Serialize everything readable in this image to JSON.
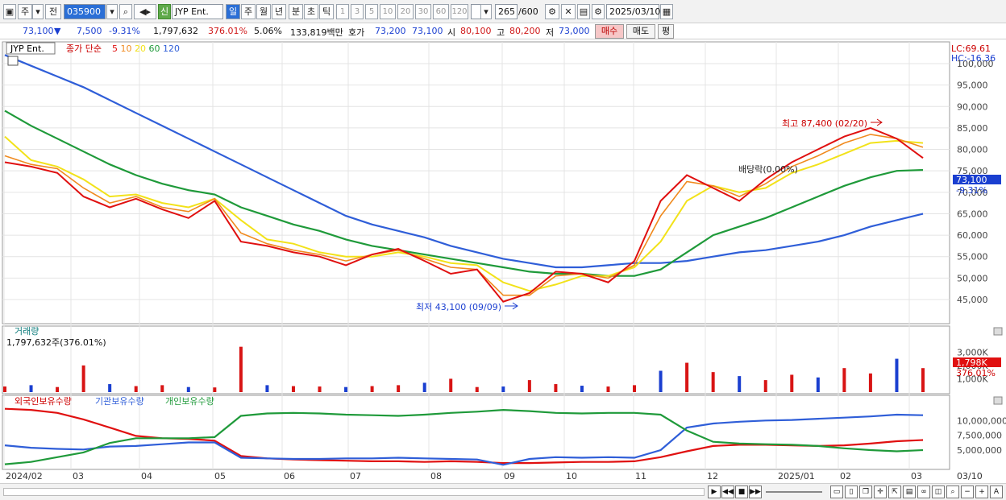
{
  "toolbar": {
    "type_select": "주",
    "prev_label": "전",
    "stock_code": "035900",
    "credit_badge": "신",
    "stock_name": "JYP Ent.",
    "periods": [
      "일",
      "주",
      "월",
      "년",
      "분",
      "초",
      "틱"
    ],
    "active_period": "일",
    "intervals": [
      "1",
      "3",
      "5",
      "10",
      "20",
      "30",
      "60",
      "120"
    ],
    "data_count": "265",
    "data_total": "/600",
    "date": "2025/03/10"
  },
  "quote": {
    "price": "73,100",
    "change": "7,500",
    "change_pct": "-9.31%",
    "volume": "1,797,632",
    "volume_ratio": "376.01%",
    "turnover": "5.06%",
    "amount": "133,819백만",
    "ask_label": "호가",
    "ask1": "73,200",
    "ask2": "73,100",
    "open_label": "시",
    "open": "80,100",
    "high_label": "고",
    "high": "80,200",
    "low_label": "저",
    "low": "73,000",
    "buy_label": "매수",
    "sell_label": "매도",
    "eval_label": "평"
  },
  "chart_labels": {
    "name_tag": "JYP Ent.",
    "ma_prefix": "종가 단순",
    "lc": "LC:69.61",
    "hc": "HC:-16.36",
    "max_annot": "최고 87,400 (02/20)",
    "min_annot": "최저 43,100 (09/09)",
    "div_annot": "배당락(0.00%)",
    "price_tag": "73,100",
    "pct_tag": "-9.31%",
    "vol_title": "거래량",
    "vol_value": "1,797,632주(376.01%)",
    "vol_tag": "1,798K",
    "vol_pct_tag": "376.01%",
    "holdings": [
      "외국인보유수량",
      "기관보유수량",
      "개인보유수량"
    ]
  },
  "colors": {
    "up": "#d81414",
    "down": "#1a3fd0",
    "ma5": "#e01010",
    "ma10": "#f08a1e",
    "ma20": "#f2e21a",
    "ma60": "#1f9a3a",
    "ma120": "#2f5ed8",
    "foreign": "#e01010",
    "institution": "#2f5ed8",
    "individual": "#1f9a3a"
  },
  "chart_data": {
    "type": "line",
    "series": [
      {
        "name": "5",
        "values": [
          77000,
          76000,
          74500,
          69000,
          66500,
          68500,
          66000,
          64000,
          68000,
          58500,
          57500,
          56000,
          55000,
          53000,
          55500,
          56800,
          54000,
          51000,
          52000,
          44500,
          46500,
          51500,
          51000,
          49000,
          54000,
          68000,
          74000,
          71000,
          68000,
          73000,
          77000,
          80000,
          83000,
          85000,
          82500,
          78000
        ]
      },
      {
        "name": "10",
        "values": [
          78500,
          76500,
          75500,
          71000,
          67500,
          69000,
          66500,
          65500,
          68500,
          60500,
          58000,
          56500,
          55500,
          54000,
          55500,
          56500,
          54500,
          52500,
          52000,
          46000,
          46000,
          50500,
          51000,
          50000,
          53000,
          64500,
          72500,
          71500,
          69000,
          72000,
          76000,
          78500,
          81500,
          83500,
          82500,
          80500
        ]
      },
      {
        "name": "20",
        "values": [
          83000,
          77500,
          76000,
          73000,
          69000,
          69500,
          67500,
          66500,
          68500,
          63500,
          59000,
          58000,
          56000,
          55000,
          55000,
          56000,
          55000,
          53500,
          53000,
          49000,
          47000,
          48500,
          50500,
          50500,
          52500,
          58500,
          68000,
          71500,
          70000,
          71000,
          74500,
          76500,
          79000,
          81500,
          82000,
          81500
        ]
      },
      {
        "name": "60",
        "values": [
          89000,
          85500,
          82500,
          79500,
          76500,
          74000,
          72000,
          70500,
          69500,
          66500,
          64500,
          62500,
          61000,
          59000,
          57500,
          56500,
          55500,
          54500,
          53500,
          52500,
          51500,
          51000,
          51000,
          50500,
          50500,
          52000,
          56000,
          60000,
          62000,
          64000,
          66500,
          69000,
          71500,
          73500,
          75000,
          75200
        ]
      },
      {
        "name": "120",
        "values": [
          102000,
          99500,
          97000,
          94500,
          91500,
          88500,
          85500,
          82500,
          79500,
          76500,
          73500,
          70500,
          67500,
          64500,
          62500,
          61000,
          59500,
          57500,
          56000,
          54500,
          53500,
          52500,
          52500,
          53000,
          53500,
          53500,
          54000,
          55000,
          56000,
          56500,
          57500,
          58500,
          60000,
          62000,
          63500,
          65000
        ]
      },
      {
        "name": "외국인보유수량",
        "values": [
          12000000,
          11800000,
          11300000,
          10200000,
          8800000,
          7400000,
          7000000,
          6900000,
          6600000,
          4000000,
          3600000,
          3400000,
          3300000,
          3200000,
          3100000,
          3100000,
          3000000,
          3100000,
          3000000,
          2800000,
          2800000,
          2900000,
          3000000,
          3000000,
          3100000,
          3800000,
          4800000,
          5700000,
          5900000,
          5900000,
          5800000,
          5700000,
          5800000,
          6100000,
          6500000,
          6700000
        ]
      },
      {
        "name": "기관보유수량",
        "values": [
          5800000,
          5400000,
          5200000,
          5100000,
          5600000,
          5700000,
          6000000,
          6300000,
          6300000,
          3700000,
          3600000,
          3500000,
          3500000,
          3600000,
          3600000,
          3700000,
          3600000,
          3500000,
          3400000,
          2500000,
          3500000,
          3800000,
          3700000,
          3800000,
          3700000,
          5000000,
          8800000,
          9500000,
          9800000,
          10000000,
          10100000,
          10300000,
          10500000,
          10700000,
          11000000,
          10900000
        ]
      },
      {
        "name": "개인보유수량",
        "values": [
          2600000,
          3000000,
          3800000,
          4600000,
          6200000,
          7000000,
          7000000,
          7000000,
          7200000,
          10800000,
          11200000,
          11300000,
          11200000,
          11000000,
          10900000,
          10800000,
          11000000,
          11300000,
          11500000,
          11800000,
          11600000,
          11300000,
          11200000,
          11300000,
          11300000,
          11000000,
          8300000,
          6400000,
          6100000,
          6000000,
          5900000,
          5700000,
          5300000,
          5000000,
          4800000,
          5000000
        ]
      }
    ],
    "volume": [
      420,
      520,
      380,
      2000,
      600,
      450,
      520,
      380,
      350,
      3400,
      520,
      450,
      420,
      380,
      450,
      520,
      700,
      1000,
      380,
      420,
      900,
      600,
      480,
      420,
      520,
      1600,
      2200,
      1500,
      1200,
      900,
      1300,
      1100,
      1800,
      1400,
      2500,
      1798
    ],
    "x_ticks": [
      "2024/02",
      "03",
      "04",
      "05",
      "06",
      "07",
      "08",
      "09",
      "10",
      "11",
      "12",
      "2025/01",
      "02",
      "03",
      "03/10"
    ],
    "price_axis": [
      "100,000",
      "95,000",
      "90,000",
      "85,000",
      "80,000",
      "75,000",
      "70,000",
      "65,000",
      "60,000",
      "55,000",
      "50,000",
      "45,000"
    ],
    "volume_axis": [
      "3,000K",
      "2,000K",
      "1,000K"
    ],
    "holdings_axis": [
      "10,000,000",
      "7,500,000",
      "5,000,000"
    ],
    "ylim": [
      40000,
      103000
    ]
  }
}
